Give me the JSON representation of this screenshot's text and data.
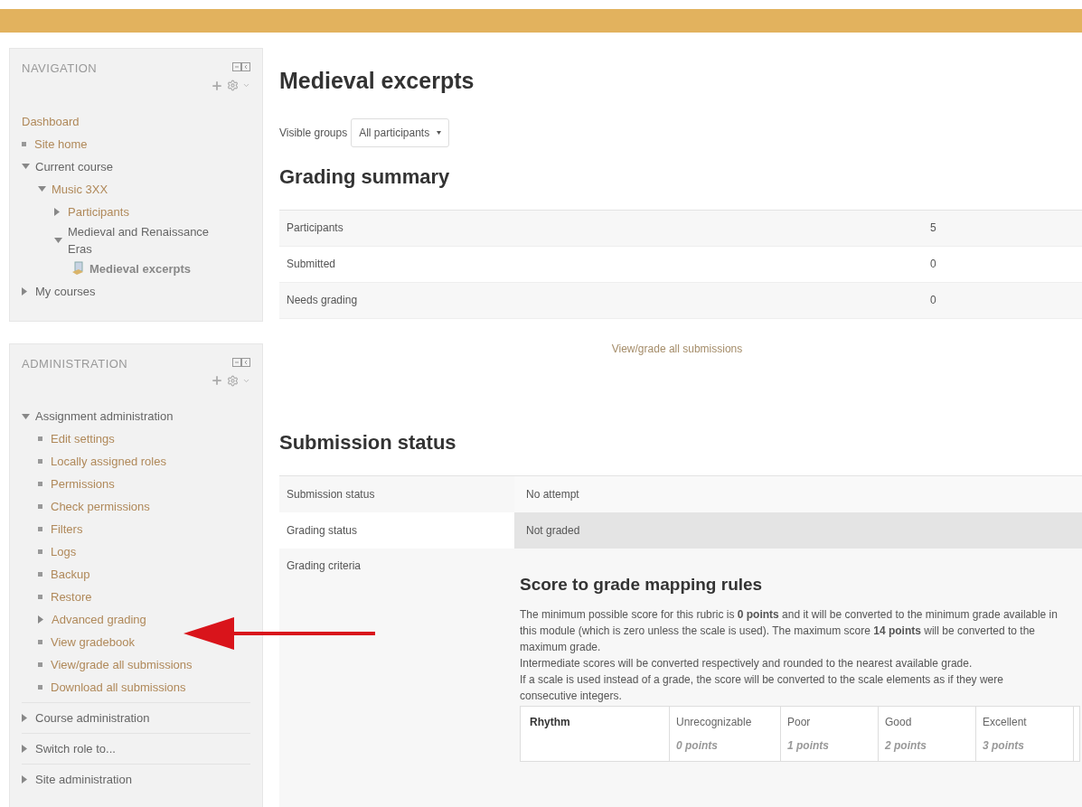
{
  "blocks": [
    {
      "title": "NAVIGATION",
      "items": [
        {
          "label": "Dashboard",
          "kind": "plain",
          "link": true
        },
        {
          "label": "Site home",
          "kind": "bullet",
          "link": true
        },
        {
          "label": "Current course",
          "kind": "branch",
          "expanded": true,
          "link": false,
          "children": [
            {
              "label": "Music 3XX",
              "kind": "branch",
              "expanded": true,
              "link": true,
              "children": [
                {
                  "label": "Participants",
                  "kind": "branch",
                  "expanded": false,
                  "link": true
                },
                {
                  "label": "Medieval and Renaissance Eras",
                  "kind": "branch",
                  "expanded": true,
                  "link": false,
                  "children": [
                    {
                      "label": "Medieval excerpts",
                      "kind": "activity",
                      "link": false
                    }
                  ]
                }
              ]
            }
          ]
        },
        {
          "label": "My courses",
          "kind": "branch",
          "expanded": false,
          "link": false
        }
      ]
    },
    {
      "title": "ADMINISTRATION",
      "items": [
        {
          "label": "Assignment administration",
          "kind": "branch",
          "expanded": true,
          "link": false,
          "children": [
            {
              "label": "Edit settings",
              "kind": "bullet",
              "link": true
            },
            {
              "label": "Locally assigned roles",
              "kind": "bullet",
              "link": true
            },
            {
              "label": "Permissions",
              "kind": "bullet",
              "link": true
            },
            {
              "label": "Check permissions",
              "kind": "bullet",
              "link": true
            },
            {
              "label": "Filters",
              "kind": "bullet",
              "link": true
            },
            {
              "label": "Logs",
              "kind": "bullet",
              "link": true
            },
            {
              "label": "Backup",
              "kind": "bullet",
              "link": true
            },
            {
              "label": "Restore",
              "kind": "bullet",
              "link": true
            },
            {
              "label": "Advanced grading",
              "kind": "branch",
              "expanded": false,
              "link": true
            },
            {
              "label": "View gradebook",
              "kind": "bullet",
              "link": true
            },
            {
              "label": "View/grade all submissions",
              "kind": "bullet",
              "link": true
            },
            {
              "label": "Download all submissions",
              "kind": "bullet",
              "link": true
            }
          ]
        },
        {
          "label": "Course administration",
          "kind": "branch",
          "expanded": false,
          "link": false
        },
        {
          "label": "Switch role to...",
          "kind": "branch",
          "expanded": false,
          "link": false
        },
        {
          "label": "Site administration",
          "kind": "branch",
          "expanded": false,
          "link": false
        }
      ]
    }
  ],
  "page": {
    "title": "Medieval excerpts",
    "group_selector": {
      "label": "Visible groups",
      "value": "All participants"
    },
    "grading_summary": {
      "heading": "Grading summary",
      "rows": [
        {
          "label": "Participants",
          "value": "5"
        },
        {
          "label": "Submitted",
          "value": "0"
        },
        {
          "label": "Needs grading",
          "value": "0"
        }
      ],
      "link": "View/grade all submissions"
    },
    "submission_status": {
      "heading": "Submission status",
      "rows": [
        {
          "label": "Submission status",
          "value": "No attempt",
          "highlighted": false
        },
        {
          "label": "Grading status",
          "value": "Not graded",
          "highlighted": true
        }
      ],
      "criteria": {
        "label": "Grading criteria",
        "heading": "Score to grade mapping rules",
        "paragraphs": [
          "The minimum possible score for this rubric is **0 points** and it will be converted to the minimum grade available in this module (which is zero unless the scale is used). The maximum score **14 points** will be converted to the maximum grade.",
          "Intermediate scores will be converted respectively and rounded to the nearest available grade.",
          "If a scale is used instead of a grade, the score will be converted to the scale elements as if they were consecutive integers."
        ],
        "rubric": [
          {
            "criterion": "Rhythm",
            "levels": [
              {
                "definition": "Unrecognizable",
                "score": "0 points"
              },
              {
                "definition": "Poor",
                "score": "1 points"
              },
              {
                "definition": "Good",
                "score": "2 points"
              },
              {
                "definition": "Excellent",
                "score": "3 points"
              }
            ]
          }
        ]
      }
    }
  }
}
